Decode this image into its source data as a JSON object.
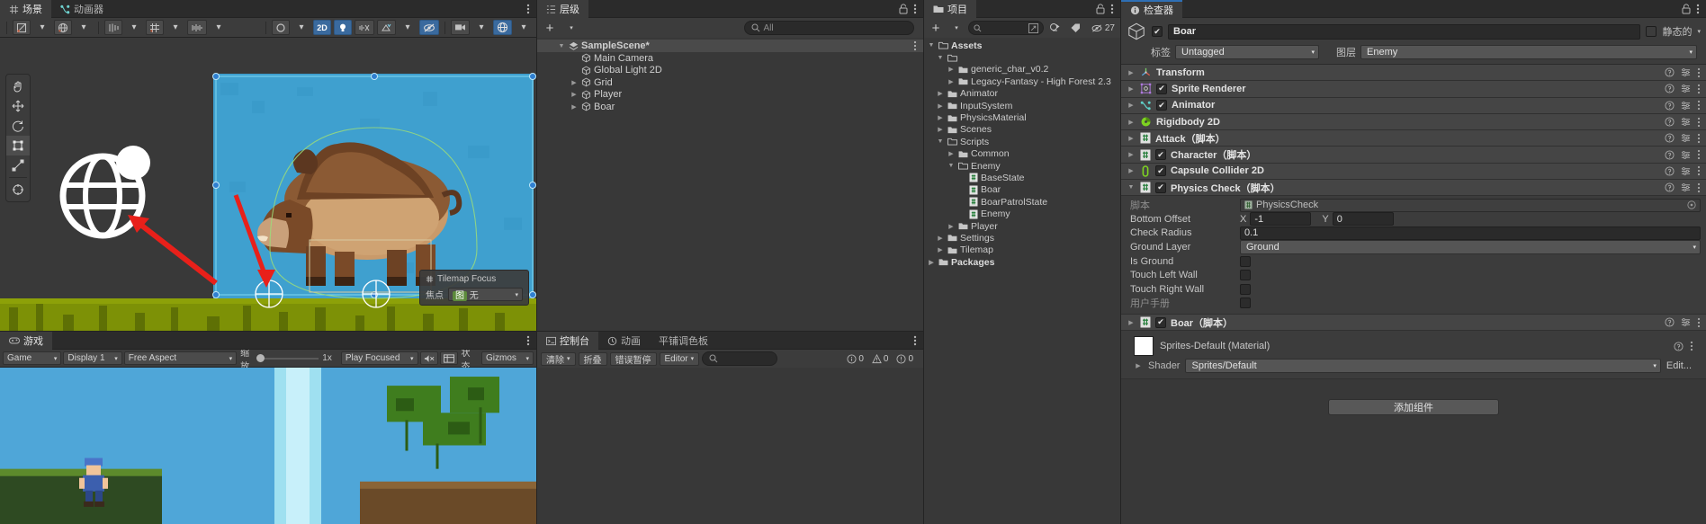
{
  "scene_panel": {
    "tabs": [
      {
        "label": "场景",
        "icon": "grid-icon",
        "active": true
      },
      {
        "label": "动画器",
        "icon": "animator-icon",
        "active": false
      }
    ],
    "toolbar": {
      "shading_label": "",
      "button_2d": "2D",
      "gizmo_label": "Gizmos",
      "items": [
        "select-tool",
        "hand-tool",
        "move-tool",
        "rotate-tool",
        "scale-tool",
        "rect-tool",
        "transform-tool"
      ]
    },
    "tool_palette": [
      "hand-tool-icon",
      "move-tool-icon",
      "rotate-tool-icon",
      "scale-tool-icon",
      "rect-tool-icon",
      "transform-tool-icon",
      "custom-tool-icon"
    ],
    "focus_overlay": {
      "title": "Tilemap Focus",
      "field_label": "焦点",
      "field_value": "无",
      "tag": "图"
    }
  },
  "game_panel": {
    "tab_label": "游戏",
    "toolbar": {
      "game_dropdown": "Game",
      "display_dropdown": "Display 1",
      "aspect_dropdown": "Free Aspect",
      "scale_label": "缩放",
      "scale_value": "1x",
      "play_focused": "Play Focused",
      "stats_label": "状态",
      "gizmos_label": "Gizmos"
    }
  },
  "hierarchy": {
    "tab_label": "层级",
    "search_placeholder": "All",
    "add_button": "+",
    "items": [
      {
        "label": "SampleScene*",
        "depth": 0,
        "arrow": "down",
        "icon": "scene-icon",
        "bold": true,
        "selected": false
      },
      {
        "label": "Main Camera",
        "depth": 1,
        "arrow": "none",
        "icon": "gameobject-icon",
        "bold": false,
        "selected": false
      },
      {
        "label": "Global Light 2D",
        "depth": 1,
        "arrow": "none",
        "icon": "gameobject-icon",
        "bold": false,
        "selected": false
      },
      {
        "label": "Grid",
        "depth": 1,
        "arrow": "right",
        "icon": "gameobject-icon",
        "bold": false,
        "selected": false
      },
      {
        "label": "Player",
        "depth": 1,
        "arrow": "right",
        "icon": "gameobject-icon",
        "bold": false,
        "selected": false
      },
      {
        "label": "Boar",
        "depth": 1,
        "arrow": "right",
        "icon": "gameobject-icon",
        "bold": false,
        "selected": false
      }
    ]
  },
  "console": {
    "tabs": [
      {
        "label": "控制台",
        "active": true
      },
      {
        "label": "动画",
        "active": false
      },
      {
        "label": "平铺调色板",
        "active": false
      }
    ],
    "toolbar": {
      "clear": "清除",
      "collapse": "折叠",
      "error_pause": "错误暂停",
      "editor": "Editor",
      "search_placeholder": "",
      "counts": {
        "log": "0",
        "warning": "0",
        "error": "0"
      }
    }
  },
  "project": {
    "tab_label": "项目",
    "search_placeholder": "",
    "hidden_count": "27",
    "tree": [
      {
        "label": "Assets",
        "depth": 0,
        "arrow": "down",
        "icon": "folder-open-icon",
        "bold": true
      },
      {
        "label": "",
        "depth": 1,
        "arrow": "down",
        "icon": "folder-open-icon",
        "bold": false
      },
      {
        "label": "generic_char_v0.2",
        "depth": 2,
        "arrow": "right",
        "icon": "folder-icon",
        "bold": false
      },
      {
        "label": "Legacy-Fantasy - High Forest 2.3",
        "depth": 2,
        "arrow": "right",
        "icon": "folder-icon",
        "bold": false
      },
      {
        "label": "Animator",
        "depth": 1,
        "arrow": "right",
        "icon": "folder-icon",
        "bold": false
      },
      {
        "label": "InputSystem",
        "depth": 1,
        "arrow": "right",
        "icon": "folder-icon",
        "bold": false
      },
      {
        "label": "PhysicsMaterial",
        "depth": 1,
        "arrow": "right",
        "icon": "folder-icon",
        "bold": false
      },
      {
        "label": "Scenes",
        "depth": 1,
        "arrow": "right",
        "icon": "folder-icon",
        "bold": false
      },
      {
        "label": "Scripts",
        "depth": 1,
        "arrow": "down",
        "icon": "folder-open-icon",
        "bold": false
      },
      {
        "label": "Common",
        "depth": 2,
        "arrow": "right",
        "icon": "folder-icon",
        "bold": false
      },
      {
        "label": "Enemy",
        "depth": 2,
        "arrow": "down",
        "icon": "folder-open-icon",
        "bold": false
      },
      {
        "label": "BaseState",
        "depth": 3,
        "arrow": "none",
        "icon": "csharp-icon",
        "bold": false
      },
      {
        "label": "Boar",
        "depth": 3,
        "arrow": "none",
        "icon": "csharp-icon",
        "bold": false
      },
      {
        "label": "BoarPatrolState",
        "depth": 3,
        "arrow": "none",
        "icon": "csharp-icon",
        "bold": false
      },
      {
        "label": "Enemy",
        "depth": 3,
        "arrow": "none",
        "icon": "csharp-icon",
        "bold": false
      },
      {
        "label": "Player",
        "depth": 2,
        "arrow": "right",
        "icon": "folder-icon",
        "bold": false
      },
      {
        "label": "Settings",
        "depth": 1,
        "arrow": "right",
        "icon": "folder-icon",
        "bold": false
      },
      {
        "label": "Tilemap",
        "depth": 1,
        "arrow": "right",
        "icon": "folder-icon",
        "bold": false
      },
      {
        "label": "Packages",
        "depth": 0,
        "arrow": "right",
        "icon": "folder-icon",
        "bold": true
      }
    ]
  },
  "inspector": {
    "tab_label": "检查器",
    "object_name": "Boar",
    "enabled": true,
    "static_label": "静态的",
    "tag_label": "标签",
    "tag_value": "Untagged",
    "layer_label": "图层",
    "layer_value": "Enemy",
    "components": [
      {
        "name": "Transform",
        "suffix": "",
        "icon": "transform-icon",
        "has_checkbox": false,
        "checked": false,
        "expanded": false
      },
      {
        "name": "Sprite Renderer",
        "suffix": "",
        "icon": "sprite-renderer-icon",
        "has_checkbox": true,
        "checked": true,
        "expanded": false
      },
      {
        "name": "Animator",
        "suffix": "",
        "icon": "animator-icon",
        "has_checkbox": true,
        "checked": true,
        "expanded": false
      },
      {
        "name": "Rigidbody 2D",
        "suffix": "",
        "icon": "rigidbody2d-icon",
        "has_checkbox": false,
        "checked": false,
        "expanded": false
      },
      {
        "name": "Attack",
        "suffix": "（脚本）",
        "icon": "csharp-icon",
        "has_checkbox": false,
        "checked": false,
        "expanded": false
      },
      {
        "name": "Character",
        "suffix": "（脚本）",
        "icon": "csharp-icon",
        "has_checkbox": true,
        "checked": true,
        "expanded": false
      },
      {
        "name": "Capsule Collider 2D",
        "suffix": "",
        "icon": "capsule-collider-icon",
        "has_checkbox": true,
        "checked": true,
        "expanded": false
      },
      {
        "name": "Physics Check",
        "suffix": "（脚本）",
        "icon": "csharp-icon",
        "has_checkbox": true,
        "checked": true,
        "expanded": true
      }
    ],
    "physics_check": {
      "script_label": "脚本",
      "script_value": "PhysicsCheck",
      "bottom_offset_label": "Bottom Offset",
      "bottom_offset_x_label": "X",
      "bottom_offset_x": "-1",
      "bottom_offset_y_label": "Y",
      "bottom_offset_y": "0",
      "check_radius_label": "Check Radius",
      "check_radius": "0.1",
      "ground_layer_label": "Ground Layer",
      "ground_layer": "Ground",
      "is_ground_label": "Is Ground",
      "is_ground": false,
      "touch_left_wall_label": "Touch Left Wall",
      "touch_left_wall": false,
      "touch_right_wall_label": "Touch Right Wall",
      "touch_right_wall": false,
      "manual_label": "用户手册",
      "manual": false
    },
    "boar_component": {
      "name": "Boar",
      "suffix": "（脚本）",
      "checked": true
    },
    "material": {
      "name": "Sprites-Default (Material)",
      "shader_label": "Shader",
      "shader_value": "Sprites/Default",
      "edit_label": "Edit..."
    },
    "add_component_label": "添加组件"
  }
}
